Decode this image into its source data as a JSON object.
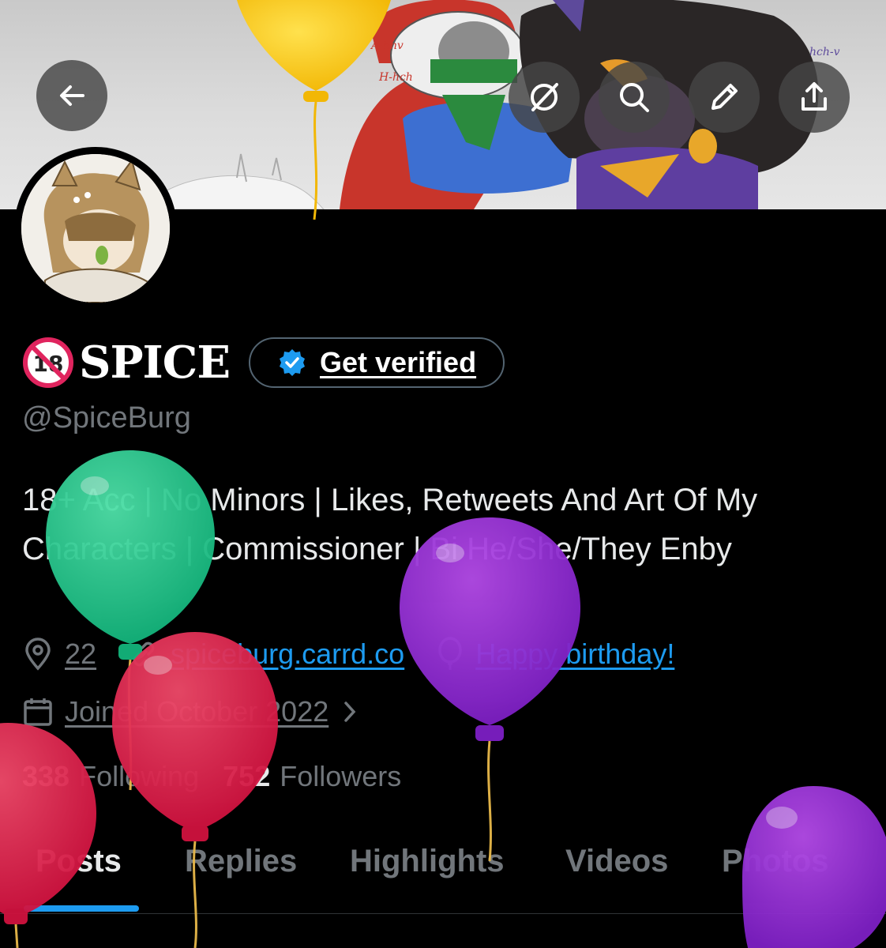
{
  "header": {
    "back_icon": "arrow-left-icon",
    "grok_icon": "grok-icon",
    "search_icon": "search-icon",
    "edit_icon": "pencil-icon",
    "share_icon": "share-icon"
  },
  "profile": {
    "name": "SPICE",
    "name_prefix_icon": "no-under-18-emoji",
    "verify_label": "Get verified",
    "handle": "@SpiceBurg",
    "bio": "18+ Acc | No Minors | Likes, Retweets And Art Of My Characters | Commissioner | Bi He/She/They Enby",
    "location": "22",
    "website": "spiceburg.carrd.co",
    "birthday": "Happy birthday!",
    "joined": "Joined October 2022",
    "following_count": "338",
    "following_label": "Following",
    "followers_count": "752",
    "followers_label": "Followers"
  },
  "tabs": [
    {
      "label": "Posts",
      "active": true
    },
    {
      "label": "Replies",
      "active": false
    },
    {
      "label": "Highlights",
      "active": false
    },
    {
      "label": "Videos",
      "active": false
    },
    {
      "label": "Photos",
      "active": false
    }
  ],
  "colors": {
    "accent": "#1d9bf0",
    "muted": "#71767b",
    "background": "#000000"
  }
}
